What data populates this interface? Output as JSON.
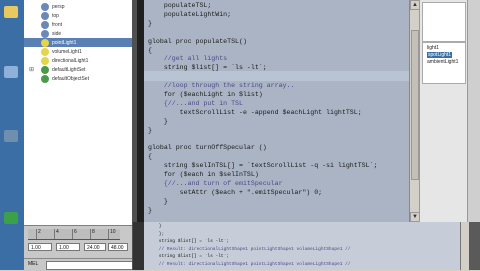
{
  "outliner": {
    "items": [
      {
        "label": "persp",
        "icon_color": "#6b88b8",
        "selected": false,
        "expanded": false
      },
      {
        "label": "top",
        "icon_color": "#6b88b8",
        "selected": false,
        "expanded": false
      },
      {
        "label": "front",
        "icon_color": "#6b88b8",
        "selected": false,
        "expanded": false
      },
      {
        "label": "side",
        "icon_color": "#6b88b8",
        "selected": false,
        "expanded": false
      },
      {
        "label": "pointLight1",
        "icon_color": "#e6d44a",
        "selected": true,
        "expanded": false
      },
      {
        "label": "volumeLight1",
        "icon_color": "#e6d44a",
        "selected": false,
        "expanded": false
      },
      {
        "label": "directionalLight1",
        "icon_color": "#e6d44a",
        "selected": false,
        "expanded": false
      },
      {
        "label": "defaultLightSet",
        "icon_color": "#4a9a4a",
        "selected": false,
        "expanded": true
      },
      {
        "label": "defaultObjectSet",
        "icon_color": "#4a9a4a",
        "selected": false,
        "expanded": false
      }
    ]
  },
  "timeslider": {
    "ticks": [
      "2",
      "4",
      "6",
      "8",
      "10"
    ],
    "start": "1.00",
    "end": "1.00",
    "range_end": "24.00",
    "range_end2": "48.00"
  },
  "mel": {
    "label": "MEL"
  },
  "editor": {
    "lines": [
      {
        "text": "    populateTSL;",
        "kind": "code"
      },
      {
        "text": "    populateLightWin;",
        "kind": "code"
      },
      {
        "text": "}",
        "kind": "code"
      },
      {
        "text": "",
        "kind": "code"
      },
      {
        "text": "global proc populateTSL()",
        "kind": "code"
      },
      {
        "text": "{",
        "kind": "code"
      },
      {
        "text": "    //get all lights",
        "kind": "com"
      },
      {
        "text": "    string $list[] = `ls -lt`;",
        "kind": "code"
      },
      {
        "text": "",
        "kind": "code"
      },
      {
        "text": "    //loop through the string array..",
        "kind": "com"
      },
      {
        "text": "    for ($eachLight in $list)",
        "kind": "code"
      },
      {
        "text": "    {//...and put in TSL",
        "kind": "com"
      },
      {
        "text": "        textScrollList -e -append $eachLight lightTSL;",
        "kind": "code"
      },
      {
        "text": "    }",
        "kind": "code"
      },
      {
        "text": "}",
        "kind": "code"
      },
      {
        "text": "",
        "kind": "code"
      },
      {
        "text": "global proc turnOffSpecular ()",
        "kind": "code"
      },
      {
        "text": "{",
        "kind": "code"
      },
      {
        "text": "    string $selInTSL[] = `textScrollList -q -si lightTSL`;",
        "kind": "code"
      },
      {
        "text": "    for ($each in $selInTSL)",
        "kind": "code"
      },
      {
        "text": "    {//...and turn of emitSpecular",
        "kind": "com"
      },
      {
        "text": "        setAttr ($each + \".emitSpecular\") 0;",
        "kind": "code"
      },
      {
        "text": "    }",
        "kind": "code"
      },
      {
        "text": "}",
        "kind": "code"
      }
    ]
  },
  "right_panel": {
    "items": [
      {
        "label": "light1",
        "selected": false
      },
      {
        "label": "spotLight1",
        "selected": true
      },
      {
        "label": "ambientLight1",
        "selected": false
      }
    ]
  },
  "bottom_editor": {
    "lines": [
      {
        "text": "    }",
        "kind": "code"
      },
      {
        "text": "    };",
        "kind": "code"
      },
      {
        "text": "    string $list[] = `ls -lt`;",
        "kind": "code"
      },
      {
        "text": "    // Result: directionalLightShape1 pointLightShape1 volumeLightShape1 //",
        "kind": "com"
      },
      {
        "text": "    string $list[] = `ls -lt`;",
        "kind": "code"
      },
      {
        "text": "    // Result: directionalLightShape1 pointLightShape1 volumeLightShape1 //",
        "kind": "com"
      }
    ]
  }
}
